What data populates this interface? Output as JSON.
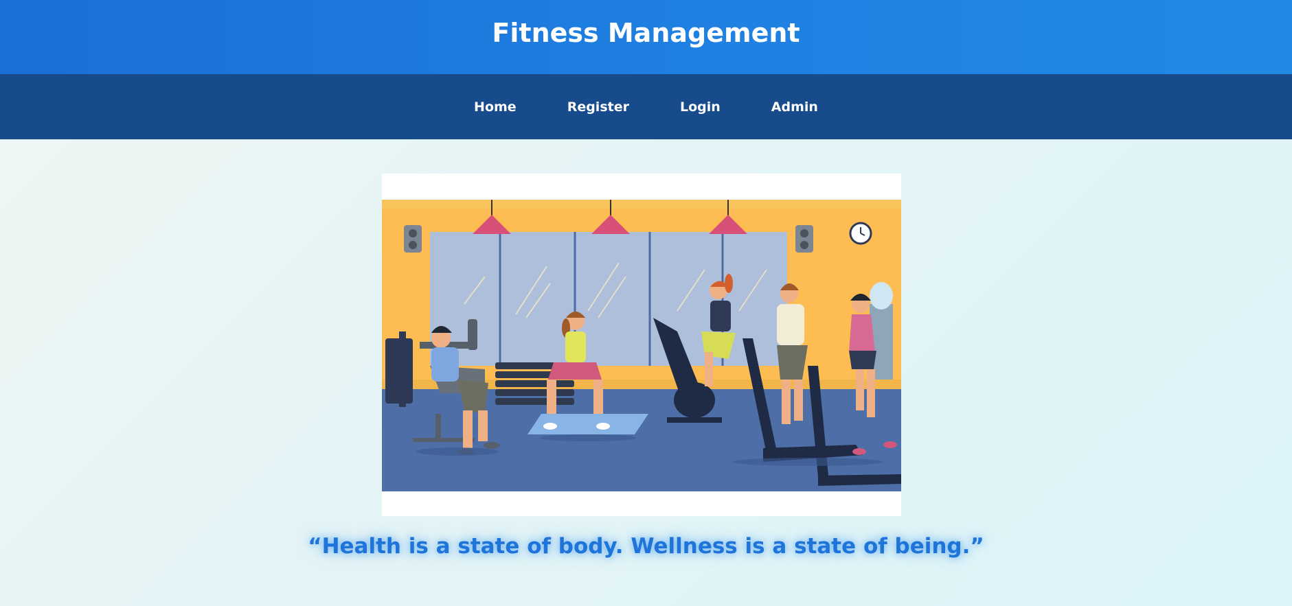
{
  "header": {
    "title": "Fitness Management"
  },
  "nav": {
    "items": [
      {
        "label": "Home"
      },
      {
        "label": "Register"
      },
      {
        "label": "Login"
      },
      {
        "label": "Admin"
      }
    ]
  },
  "hero": {
    "image": "gym-illustration"
  },
  "quote": {
    "text": "“Health is a state of body. Wellness is a state of being.”"
  },
  "colors": {
    "header_bg": "#1f7ce0",
    "nav_bg": "#174b8c",
    "quote_color": "#1e74d8"
  }
}
